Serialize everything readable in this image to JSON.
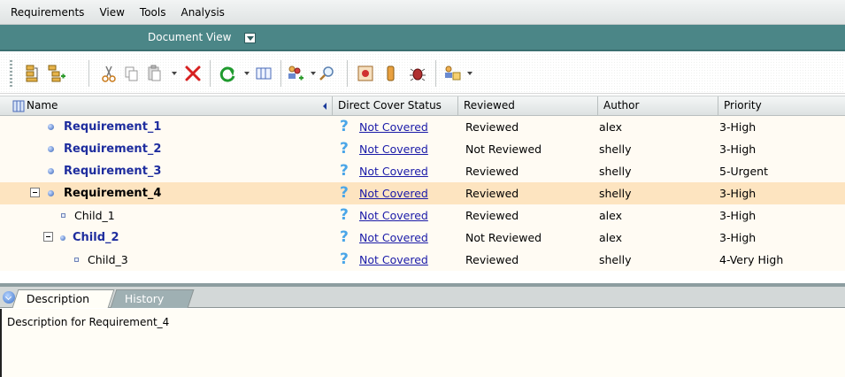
{
  "menu": {
    "items": [
      "Requirements",
      "View",
      "Tools",
      "Analysis"
    ]
  },
  "view_bar": {
    "label": "Document View"
  },
  "toolbar": {
    "icons": [
      "new-requirement-icon",
      "new-child-requirement-icon",
      "cut-icon",
      "copy-icon",
      "paste-icon",
      "delete-icon",
      "refresh-icon",
      "columns-icon",
      "add-users-icon",
      "find-icon",
      "link-icon",
      "attachment-icon",
      "bug-icon",
      "user-group-icon"
    ]
  },
  "grid": {
    "columns": {
      "name": "Name",
      "status": "Direct Cover Status",
      "reviewed": "Reviewed",
      "author": "Author",
      "priority": "Priority"
    },
    "rows": [
      {
        "name": "Requirement_1",
        "level": 0,
        "style": "bold",
        "status": "Not Covered",
        "reviewed": "Reviewed",
        "author": "alex",
        "priority": "3-High"
      },
      {
        "name": "Requirement_2",
        "level": 0,
        "style": "bold",
        "status": "Not Covered",
        "reviewed": "Not Reviewed",
        "author": "shelly",
        "priority": "3-High"
      },
      {
        "name": "Requirement_3",
        "level": 0,
        "style": "bold",
        "status": "Not Covered",
        "reviewed": "Reviewed",
        "author": "shelly",
        "priority": "5-Urgent"
      },
      {
        "name": "Requirement_4",
        "level": 0,
        "style": "bold-selected",
        "status": "Not Covered",
        "reviewed": "Reviewed",
        "author": "shelly",
        "priority": "3-High",
        "expanded": true
      },
      {
        "name": "Child_1",
        "level": 1,
        "style": "plain",
        "status": "Not Covered",
        "reviewed": "Reviewed",
        "author": "alex",
        "priority": "3-High"
      },
      {
        "name": "Child_2",
        "level": 1,
        "style": "bold",
        "status": "Not Covered",
        "reviewed": "Not Reviewed",
        "author": "alex",
        "priority": "3-High",
        "expanded": true
      },
      {
        "name": "Child_3",
        "level": 2,
        "style": "plain",
        "status": "Not Covered",
        "reviewed": "Reviewed",
        "author": "shelly",
        "priority": "4-Very High"
      }
    ]
  },
  "details": {
    "tabs": [
      "Description",
      "History"
    ],
    "description": "Description for Requirement_4"
  }
}
